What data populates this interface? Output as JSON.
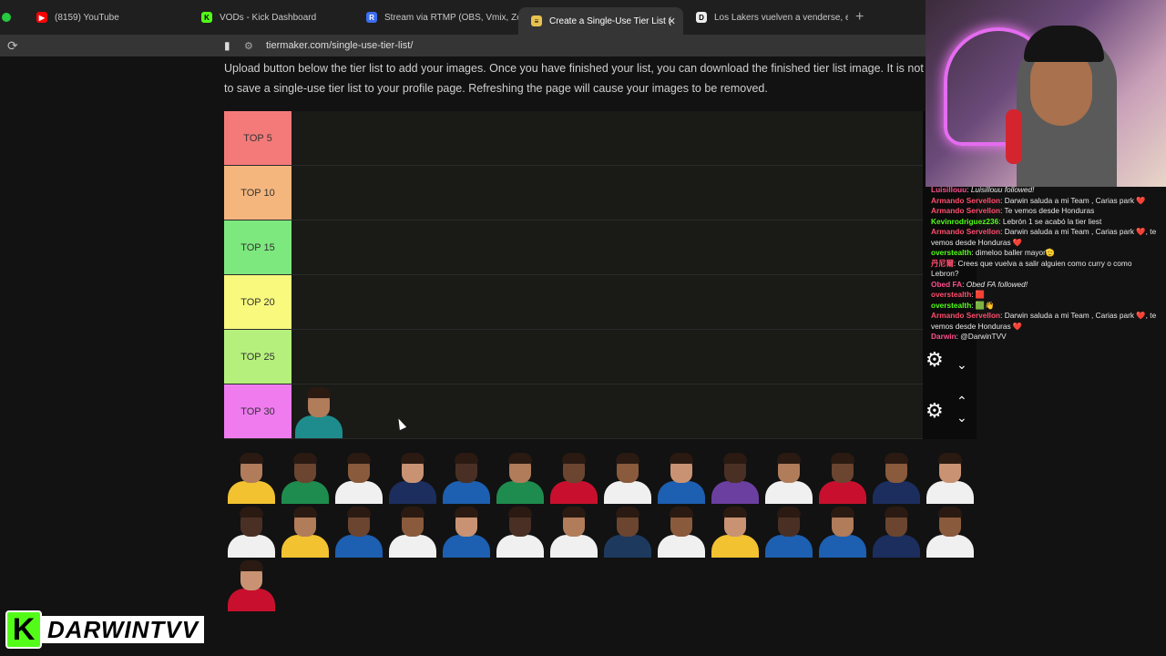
{
  "tabs": [
    {
      "label": "(8159) YouTube",
      "icon": "youtube-icon",
      "color": "#ff0000",
      "glyph": "▶"
    },
    {
      "label": "VODs - Kick Dashboard",
      "icon": "kick-icon",
      "color": "#53fc18",
      "glyph": "K"
    },
    {
      "label": "Stream via RTMP (OBS, Vmix, Zoo",
      "icon": "restream-icon",
      "color": "#3a6df0",
      "glyph": "R"
    },
    {
      "label": "Create a Single-Use Tier List (",
      "icon": "tiermaker-icon",
      "color": "#e8c250",
      "glyph": "≡",
      "active": true
    },
    {
      "label": "Los Lakers vuelven a venderse, es",
      "icon": "news-icon",
      "color": "#eeeeee",
      "glyph": "D"
    }
  ],
  "new_tab_glyph": "+",
  "address": {
    "url": "tiermaker.com/single-use-tier-list/"
  },
  "intro_lines": [
    "Upload button below the tier list to add your images. Once you have finished your list, you can download the finished tier list image. It is not",
    "to save a single-use tier list to your profile page. Refreshing the page will cause your images to be removed."
  ],
  "tiers": [
    {
      "label": "TOP 5",
      "color": "#f47a7a"
    },
    {
      "label": "TOP 10",
      "color": "#f5b67e"
    },
    {
      "label": "TOP 15",
      "color": "#7de87e"
    },
    {
      "label": "TOP 20",
      "color": "#f8f97d"
    },
    {
      "label": "TOP 25",
      "color": "#b5f07c"
    },
    {
      "label": "TOP 30",
      "color": "#ef7bef"
    }
  ],
  "pool_jersey_colors": [
    "#f2c230",
    "#1e8c4e",
    "#f0f0f0",
    "#1b2e5e",
    "#1d5fb0",
    "#1e8c4e",
    "#c8102e",
    "#f0f0f0",
    "#1d5fb0",
    "#6b3fa0",
    "#f0f0f0",
    "#c8102e",
    "#1b2e5e",
    "#f0f0f0",
    "#f0f0f0",
    "#f2c230",
    "#1d5fb0",
    "#f0f0f0",
    "#1d5fb0",
    "#f0f0f0",
    "#f0f0f0",
    "#1d3a5e",
    "#f0f0f0",
    "#f2c230",
    "#1d5fb0",
    "#1d5fb0",
    "#1b2e5e",
    "#f0f0f0",
    "#c8102e"
  ],
  "tier30_player_color": "#1e8c8c",
  "chat": [
    {
      "user": "Luisillouu",
      "text": "Luisillouu followed!",
      "color": "#ff4d8d",
      "system": true
    },
    {
      "user": "Armando Servellon",
      "text": "Darwin saluda a mi Team , Carias park ❤️",
      "color": "#ff4d6d"
    },
    {
      "user": "Armando Servellon",
      "text": "Te vemos desde Honduras",
      "color": "#ff4d6d"
    },
    {
      "user": "Kevinrodriguez236",
      "text": "Lebrón 1 se acabó la tier liest",
      "color": "#53fc18"
    },
    {
      "user": "Armando Servellon",
      "text": "Darwin saluda a mi Team , Carias park ❤️, te vemos desde Honduras ❤️",
      "color": "#ff4d6d"
    },
    {
      "user": "overstealth",
      "text": "dimeloo baller mayor🫡",
      "color": "#53fc18"
    },
    {
      "user": "丹尼爾",
      "text": "Crees que vuelva a salir alguien como curry o como Lebron?",
      "color": "#ff4d6d"
    },
    {
      "user": "Obed FA",
      "text": "Obed FA followed!",
      "color": "#ff4d8d",
      "system": true
    },
    {
      "user": "overstealth",
      "text": "🟥",
      "color": "#ff4d6d"
    },
    {
      "user": "overstealth",
      "text": "🟩👋",
      "color": "#53fc18"
    },
    {
      "user": "Armando Servellon",
      "text": "Darwin saluda a mi Team , Carias park ❤️, te vemos desde Honduras ❤️",
      "color": "#ff4d6d"
    },
    {
      "user": "Darwin",
      "text": "@DarwinTVV",
      "color": "#ff4d8d"
    }
  ],
  "controls": {
    "gear": "⚙",
    "up": "⌃",
    "down": "⌄"
  },
  "brand": {
    "k": "K",
    "name": "DARWINTVV"
  }
}
